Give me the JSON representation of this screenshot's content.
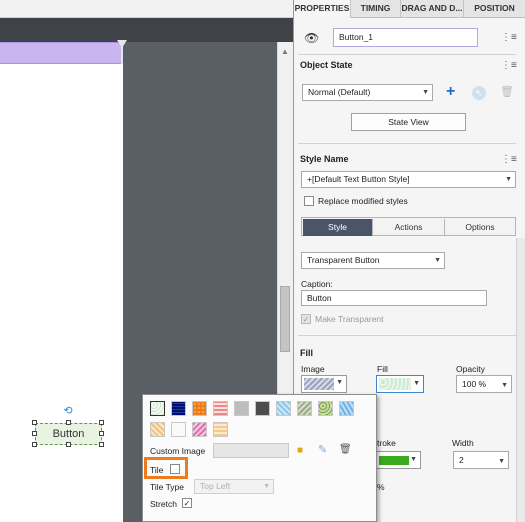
{
  "stage": {
    "object_caption": "Button"
  },
  "panel": {
    "tabs": [
      {
        "label": "PROPERTIES",
        "active": true
      },
      {
        "label": "TIMING",
        "active": false
      },
      {
        "label": "DRAG AND D...",
        "active": false
      },
      {
        "label": "POSITION",
        "active": false
      }
    ],
    "object_name": "Button_1",
    "object_state": {
      "title": "Object State",
      "selected_state": "Normal (Default)",
      "state_view_label": "State View"
    },
    "style": {
      "title": "Style Name",
      "selected_style": "+[Default Text Button Style]",
      "replace_label": "Replace modified styles",
      "replace_checked": false
    },
    "sub_tabs": [
      {
        "label": "Style",
        "active": true
      },
      {
        "label": "Actions",
        "active": false
      },
      {
        "label": "Options",
        "active": false
      }
    ],
    "button_type": "Transparent Button",
    "caption_label": "Caption:",
    "caption_value": "Button",
    "make_transparent_label": "Make Transparent",
    "make_transparent_checked": true,
    "fill": {
      "title": "Fill",
      "image_label": "Image",
      "fill_label": "Fill",
      "opacity_label": "Opacity",
      "opacity_value": "100 %"
    },
    "stroke": {
      "stroke_label": "troke",
      "stroke_color": "#3aaa1e",
      "width_label": "Width",
      "width_value": "2",
      "partial_percent": "%"
    }
  },
  "popup": {
    "custom_image_label": "Custom Image",
    "tile_label": "Tile",
    "tile_checked": false,
    "tile_type_label": "Tile Type",
    "tile_type_value": "Top Left",
    "stretch_label": "Stretch",
    "stretch_checked": true
  },
  "colors": {
    "accent_orange": "#f07b1d",
    "active_tab": "#4b5568",
    "timeline_bar": "#c9b6f0",
    "stage_bg": "#5a5f66"
  }
}
